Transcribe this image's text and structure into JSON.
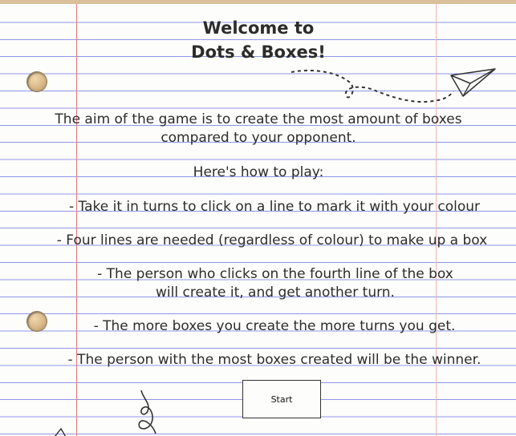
{
  "title": {
    "line1": "Welcome to",
    "line2": "Dots & Boxes!"
  },
  "intro": {
    "line1": "The aim of the game is to create the most amount of boxes",
    "line2": "compared to your opponent."
  },
  "how_to_play_heading": "Here's how to play:",
  "rules": {
    "rule1": "- Take it in turns to click on a line to mark it with your colour",
    "rule2": "- Four lines are needed (regardless of colour) to make up a box",
    "rule3_line1": "- The person who clicks on the fourth line of the box",
    "rule3_line2": "will create it, and get another turn.",
    "rule4": "- The more boxes you create the more turns you get.",
    "rule5": "- The person with the most boxes created will be the winner."
  },
  "start_button_label": "Start",
  "colors": {
    "paper": "#fdfdfb",
    "ruled_line": "#8e96e8",
    "margin_line": "#e7777a",
    "text": "#2c2c2c",
    "desk": "#d9c09a"
  },
  "icons": [
    "paper-plane-icon",
    "doodle-swirl-icon"
  ]
}
